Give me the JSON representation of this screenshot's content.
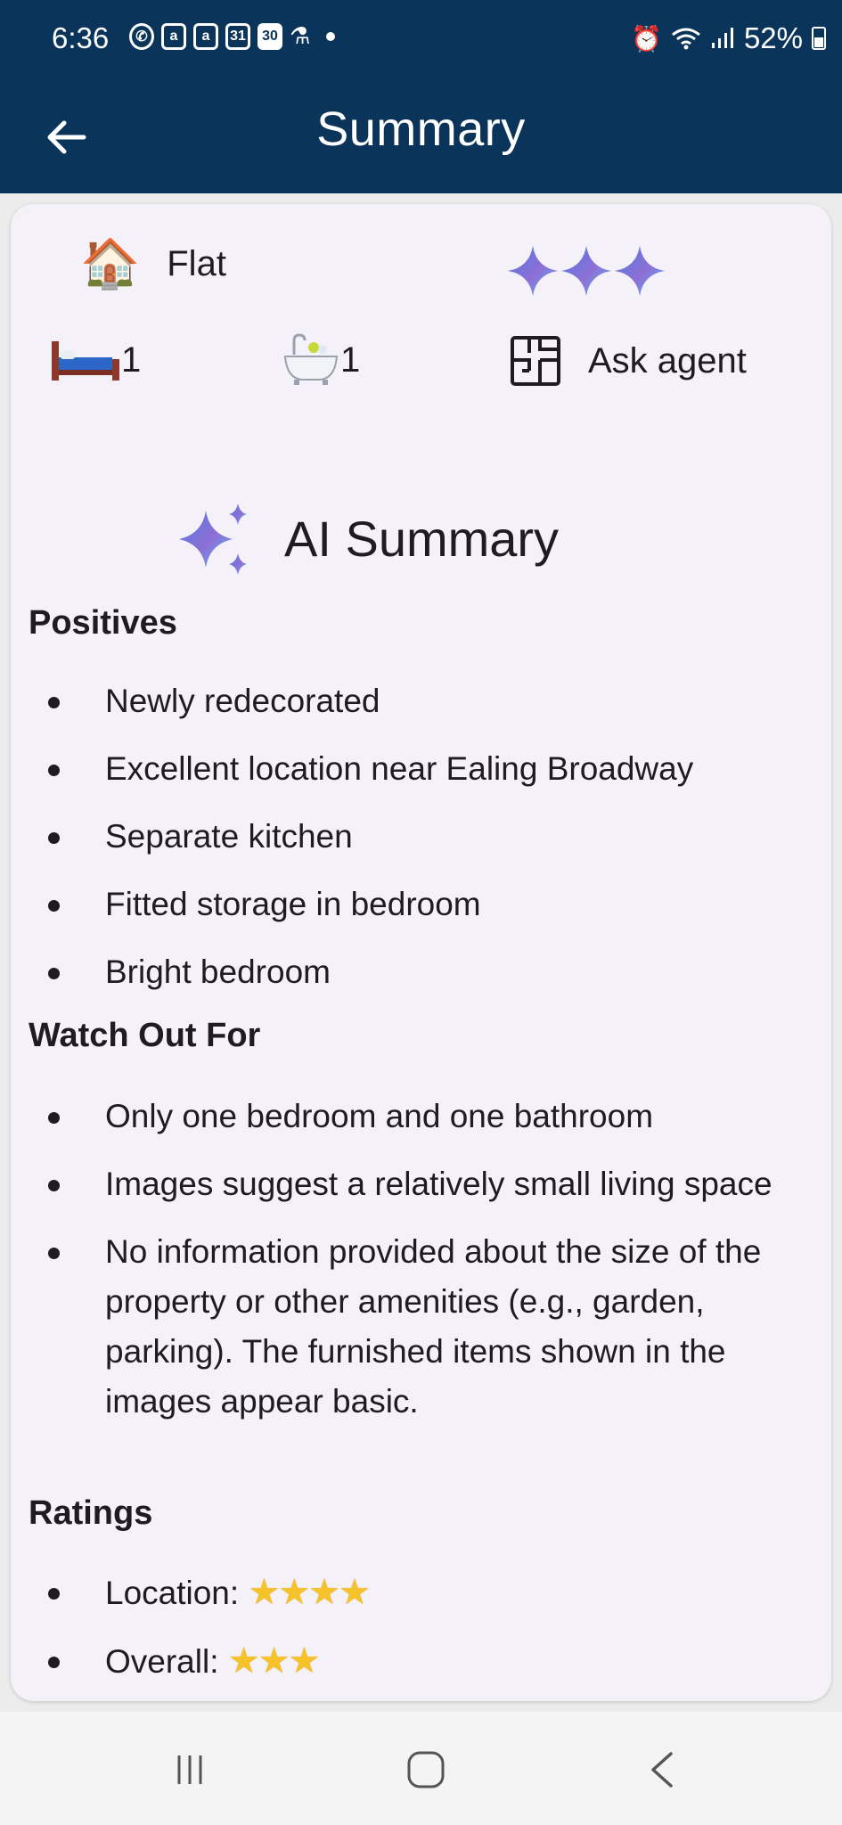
{
  "status_bar": {
    "time": "6:36",
    "notif_a1": "a",
    "notif_a2": "a",
    "notif_cal31": "31",
    "notif_cal30": "30",
    "battery": "52%"
  },
  "app_bar": {
    "title": "Summary"
  },
  "features": {
    "property_type": "Flat",
    "property_emoji": "🏠",
    "sparkles": "✦✦✦",
    "bed_emoji": "🛏",
    "bedrooms": "1",
    "bath_emoji": "🛁",
    "bathrooms": "1",
    "floorplan_label": "Ask agent"
  },
  "ai_summary": {
    "title": "AI Summary",
    "positives_title": "Positives",
    "positives": [
      "Newly redecorated",
      "Excellent location near Ealing Broadway",
      "Separate kitchen",
      "Fitted storage in bedroom",
      "Bright bedroom"
    ],
    "watch_out_title": "Watch Out For",
    "watch_out": [
      "Only one bedroom and one bathroom",
      "Images suggest a relatively small living space",
      "No information provided about the size of the property or other amenities (e.g., garden, parking).  The furnished items shown in the images appear basic."
    ],
    "ratings_title": "Ratings",
    "ratings": [
      {
        "label": "Location:",
        "stars": "★★★★",
        "value": 4
      },
      {
        "label": "Overall:",
        "stars": "★★★",
        "value": 3
      }
    ]
  },
  "colors": {
    "header_bg": "#0a3459",
    "card_bg": "#f5f1f8",
    "star": "#f6c22a",
    "sparkle_gradient": [
      "#4f7be0",
      "#8d6fd6",
      "#5ab6ee"
    ]
  },
  "icons": {
    "back": "arrow-left-icon",
    "floorplan": "floorplan-icon",
    "nav_recents": "recents-icon",
    "nav_home": "home-icon",
    "nav_back": "chevron-left-icon"
  }
}
